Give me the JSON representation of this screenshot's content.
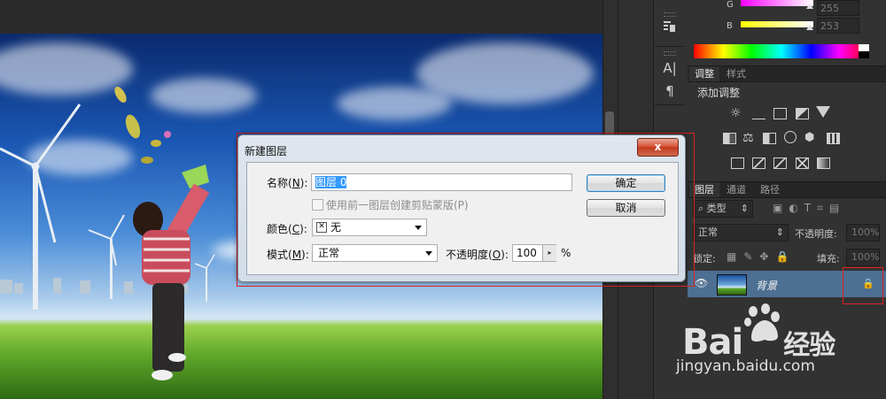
{
  "colors": {
    "panel_bg": "#323232",
    "accent_selected_layer": "#4d6f92",
    "highlight_box": "#e02020",
    "dialog_selection": "#3399ff"
  },
  "color_panel": {
    "g_label": "G",
    "g_value": "255",
    "b_label": "B",
    "b_value": "253"
  },
  "adjust_panel": {
    "tabs": [
      "调整",
      "样式"
    ],
    "add_label": "添加调整"
  },
  "layers_panel": {
    "tabs": [
      "图层",
      "通道",
      "路径"
    ],
    "filter_kind": "类型",
    "blend_mode": "正常",
    "opacity_label": "不透明度:",
    "opacity_value": "100%",
    "lock_label": "锁定:",
    "fill_label": "填充:",
    "fill_value": "100%",
    "layers": [
      {
        "name": "背景",
        "visible": true,
        "locked": true,
        "selected": true
      }
    ]
  },
  "dialog": {
    "title": "新建图层",
    "close_label": "x",
    "name_label": "名称(",
    "name_key": "N",
    "name_label_end": "):",
    "name_value": "图层 0",
    "clip_checkbox_label": "使用前一图层创建剪贴蒙版(P)",
    "color_label": "颜色(",
    "color_key": "C",
    "color_label_end": "):",
    "color_value": "无",
    "mode_label": "模式(",
    "mode_key": "M",
    "mode_label_end": "):",
    "mode_value": "正常",
    "opacity_label": "不透明度(",
    "opacity_key": "O",
    "opacity_label_end": "):",
    "opacity_value": "100",
    "percent": "%",
    "ok_label": "确定",
    "cancel_label": "取消"
  },
  "watermark": {
    "brand": "Bai",
    "brand_cn": "经验",
    "url": "jingyan.baidu.com"
  }
}
